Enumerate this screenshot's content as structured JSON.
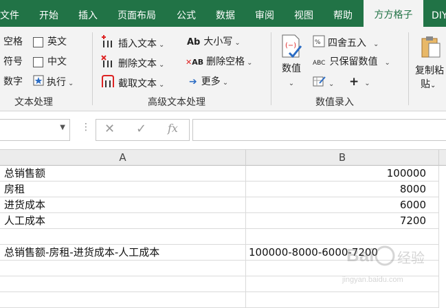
{
  "colors": {
    "accent": "#217346"
  },
  "tabs": [
    "文件",
    "开始",
    "插入",
    "页面布局",
    "公式",
    "数据",
    "审阅",
    "视图",
    "帮助",
    "方方格子",
    "DIY"
  ],
  "active_tab": "方方格子",
  "ribbon": {
    "text_group": {
      "items": [
        "空格",
        "符号",
        "数字"
      ],
      "checks": [
        "英文",
        "中文"
      ],
      "exec": "执行",
      "label": "文本处理"
    },
    "advanced_group": {
      "insert": "插入文本",
      "delete": "删除文本",
      "extract": "截取文本",
      "case": "大小写",
      "case_icon_text": "Ab",
      "delete_space": "删除空格",
      "delete_space_icon_text": "AB",
      "more": "更多",
      "label": "高级文本处理"
    },
    "number_group": {
      "value_btn": "数值",
      "round": "四舍五入",
      "keep_value": "只保留数值",
      "keep_value_icon_text": "ABC",
      "plus": "+",
      "label": "数值录入"
    },
    "paste_group": {
      "line1": "复制粘",
      "line2": "贴"
    }
  },
  "formula_bar": {
    "cancel": "✕",
    "enter": "✓",
    "fx": "fx"
  },
  "columns": [
    "A",
    "B"
  ],
  "rows": [
    {
      "a": "总销售额",
      "b": "100000"
    },
    {
      "a": "房租",
      "b": "8000"
    },
    {
      "a": "进货成本",
      "b": "6000"
    },
    {
      "a": "人工成本",
      "b": "7200"
    },
    {
      "a": "",
      "b": ""
    },
    {
      "a": "总销售额-房租-进货成本-人工成本",
      "b": "100000-8000-6000-7200"
    },
    {
      "a": "",
      "b": ""
    },
    {
      "a": "",
      "b": ""
    }
  ],
  "watermark": {
    "line1": "Bai",
    "line2": "经验",
    "url": "jingyan.baidu.com"
  }
}
